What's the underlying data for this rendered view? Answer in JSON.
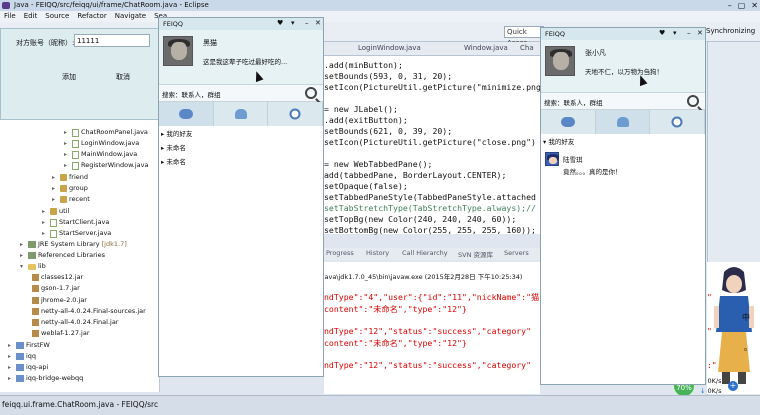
{
  "eclipse": {
    "title": "Java - FEIQQ/src/feiqq/ui/frame/ChatRoom.java - Eclipse",
    "menu": [
      "File",
      "Edit",
      "Source",
      "Refactor",
      "Navigate",
      "Sea"
    ],
    "quick_access": "Quick Acces",
    "synchronizing": "Synchronizing",
    "status": "feiqq.ui.frame.ChatRoom.java - FEIQQ/src"
  },
  "login": {
    "account_label": "对方账号（昵称）:",
    "account_value": "11111",
    "add_label": "添加",
    "cancel_label": "取消"
  },
  "explorer": {
    "rows": [
      {
        "icon": "file",
        "label": "ChatRoomPanel.java"
      },
      {
        "icon": "file",
        "label": "LoginWindow.java"
      },
      {
        "icon": "file",
        "label": "MainWindow.java"
      },
      {
        "icon": "file",
        "label": "RegisterWindow.java"
      },
      {
        "icon": "pkg",
        "label": "friend"
      },
      {
        "icon": "pkg",
        "label": "group"
      },
      {
        "icon": "pkg",
        "label": "recent"
      },
      {
        "icon": "pkg",
        "label": "util"
      },
      {
        "icon": "file",
        "label": "StartClient.java"
      },
      {
        "icon": "file",
        "label": "StartServer.java"
      },
      {
        "icon": "lib",
        "label": "JRE System Library",
        "tag": "[jdk1.7]"
      },
      {
        "icon": "lib",
        "label": "Referenced Libraries"
      },
      {
        "icon": "folder",
        "label": "lib"
      },
      {
        "icon": "jar",
        "label": "classes12.jar"
      },
      {
        "icon": "jar",
        "label": "gson-1.7.jar"
      },
      {
        "icon": "jar",
        "label": "jhrome-2.0.jar"
      },
      {
        "icon": "jar",
        "label": "netty-all-4.0.24.Final-sources.jar"
      },
      {
        "icon": "jar",
        "label": "netty-all-4.0.24.Final.jar"
      },
      {
        "icon": "jar",
        "label": "weblaf-1.27.jar"
      },
      {
        "icon": "proj",
        "label": "FirstFW"
      },
      {
        "icon": "proj",
        "label": "iqq"
      },
      {
        "icon": "proj",
        "label": "iqq-api"
      },
      {
        "icon": "proj",
        "label": "iqq-bridge-webqq"
      }
    ]
  },
  "editor": {
    "tabs": [
      "LoginWindow.java",
      "Window.java",
      "Cha"
    ],
    "lines": [
      ".add(minButton);",
      "setBounds(593, 0, 31, 20);",
      "setIcon(PictureUtil.getPicture(\"minimize.png",
      "",
      "= new JLabel();",
      ".add(exitButton);",
      "setBounds(621, 0, 39, 20);",
      "setIcon(PictureUtil.getPicture(\"close.png\")",
      "",
      "= new WebTabbedPane();",
      "add(tabbedPane, BorderLayout.CENTER);",
      "setOpaque(false);",
      "setTabbedPaneStyle(TabbedPaneStyle.attached",
      "setTabStretchType(TabStretchType.always);//",
      "setTopBg(new Color(240, 240, 240, 60));",
      "setBottomBg(new Color(255, 255, 255, 160));"
    ]
  },
  "console": {
    "tabs": [
      "Progress",
      "History",
      "Call Hierarchy",
      "SVN 资源库",
      "Servers"
    ],
    "path": "es\\Java\\jdk1.7.0_45\\bin\\javaw.exe (2015年2月28日 下午10:25:34)",
    "lines": [
      "ndType\":\"4\",\"user\":{\"id\":\"11\",\"nickName\":\"猫",
      "content\":\"未命名\",\"type\":\"12\"}",
      "",
      "ndType\":\"12\",\"status\":\"success\",\"category\"",
      "content\":\"未命名\",\"type\":\"12\"}",
      "",
      "ndType\":\"12\",\"status\":\"success\",\"category\""
    ],
    "right_chars": [
      "\"",
      "",
      "\"",
      "",
      ":\""
    ]
  },
  "feiqq_left": {
    "title": "FEIQQ",
    "name": "黑猫",
    "signature": "这是我这辈子吃过最好吃的...",
    "search_label": "搜索：联系人，群组",
    "groups": [
      "我的好友",
      "未命名",
      "未命名"
    ]
  },
  "feiqq_right": {
    "title": "FEIQQ",
    "name": "张小凡",
    "signature": "天地不仁，以万物为刍狗！",
    "search_label": "搜索：联系人，群组",
    "group": "我的好友",
    "contact_name": "陆雪琪",
    "contact_message": "竟然。。。真的是你！"
  },
  "network": {
    "percent": "70%",
    "up": "0K/s",
    "down": "0K/s",
    "chinese_chars": [
      "中",
      "。"
    ]
  }
}
